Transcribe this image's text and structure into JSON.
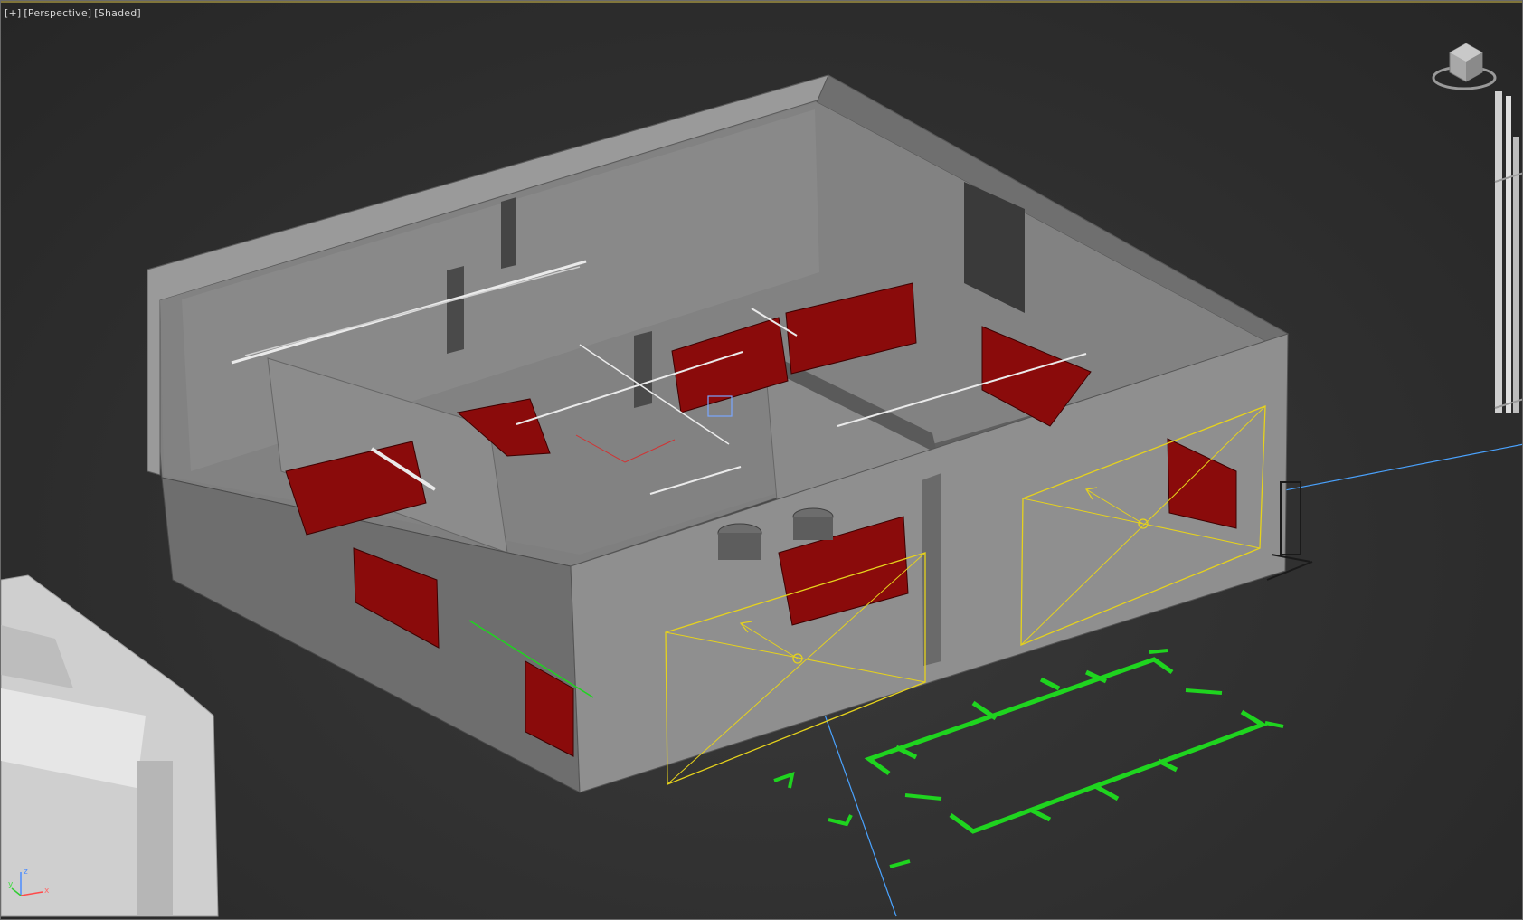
{
  "viewport": {
    "menu_label": "[+]",
    "view_label": "[Perspective]",
    "shading_label": "[Shaded]"
  },
  "axis": {
    "x": "x",
    "y": "y",
    "z": "z"
  },
  "viewcube": {
    "icon": "viewcube-icon"
  },
  "colors": {
    "background": "#2f2f2f",
    "building_wall": "#8e8e8e",
    "building_dark": "#606060",
    "floor": "#7d7d7d",
    "red_objects": "#8a0b0b",
    "light_gizmo": "#e6d21c",
    "helper_green": "#1fd41f",
    "axis_blue": "#4aa3ff"
  }
}
